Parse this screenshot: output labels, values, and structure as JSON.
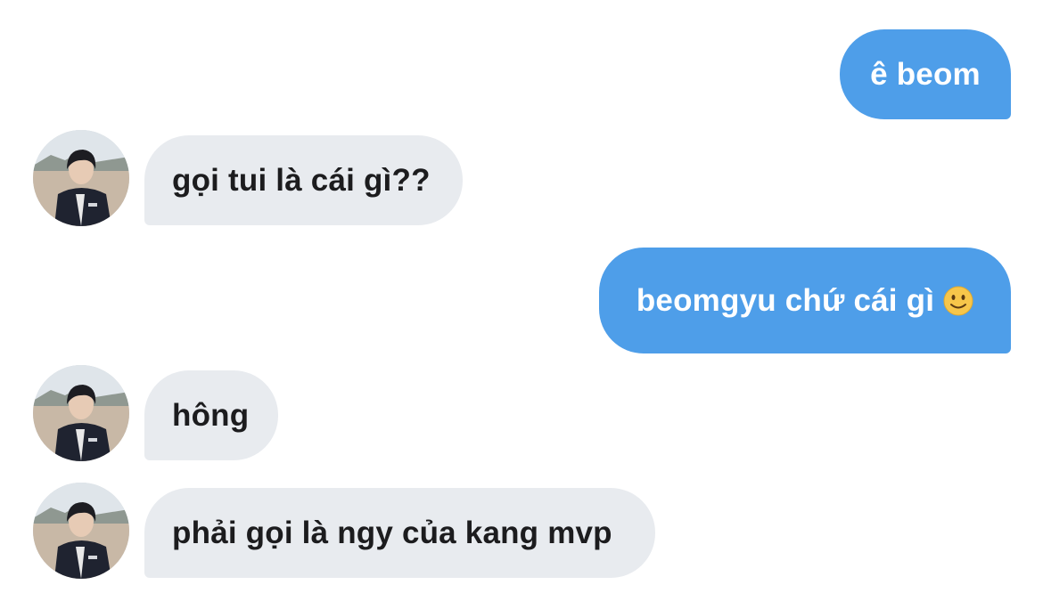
{
  "messages": [
    {
      "side": "sent",
      "text": "ê beom"
    },
    {
      "side": "received",
      "text": "gọi tui là cái gì??"
    },
    {
      "side": "sent",
      "text": "beomgyu chứ cái gì",
      "emoji": "slightly-smiling-face"
    },
    {
      "side": "received",
      "text": "hông"
    },
    {
      "side": "received",
      "text": "phải gọi là ngy của kang mvp"
    }
  ],
  "colors": {
    "sent_bubble": "#4e9ee9",
    "received_bubble": "#e8ebef",
    "sent_text": "#ffffff",
    "received_text": "#1c1c1e"
  },
  "icons": {
    "avatar": "contact-avatar-photo",
    "emoji": "slightly-smiling-face"
  }
}
